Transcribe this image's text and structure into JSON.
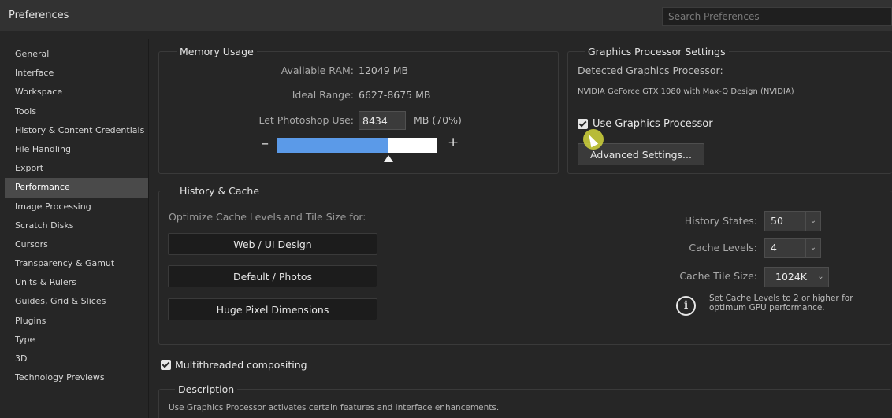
{
  "window": {
    "title": "Preferences"
  },
  "search": {
    "placeholder": "Search Preferences"
  },
  "sidebar": {
    "items": [
      {
        "label": "General"
      },
      {
        "label": "Interface"
      },
      {
        "label": "Workspace"
      },
      {
        "label": "Tools"
      },
      {
        "label": "History & Content Credentials"
      },
      {
        "label": "File Handling"
      },
      {
        "label": "Export"
      },
      {
        "label": "Performance",
        "selected": true
      },
      {
        "label": "Image Processing"
      },
      {
        "label": "Scratch Disks"
      },
      {
        "label": "Cursors"
      },
      {
        "label": "Transparency & Gamut"
      },
      {
        "label": "Units & Rulers"
      },
      {
        "label": "Guides, Grid & Slices"
      },
      {
        "label": "Plugins"
      },
      {
        "label": "Type"
      },
      {
        "label": "3D"
      },
      {
        "label": "Technology Previews"
      }
    ]
  },
  "memory": {
    "title": "Memory Usage",
    "available_label": "Available RAM:",
    "available_value": "12049 MB",
    "ideal_label": "Ideal Range:",
    "ideal_value": "6627-8675 MB",
    "use_label": "Let Photoshop Use:",
    "use_value": "8434",
    "use_unit": "MB (70%)",
    "slider_fraction": 0.7,
    "slider_minus": "–",
    "slider_plus": "+"
  },
  "gpu": {
    "title": "Graphics Processor Settings",
    "detected_label": "Detected Graphics Processor:",
    "detected_value": "NVIDIA GeForce GTX 1080 with Max-Q Design (NVIDIA)",
    "use_gpu_label": "Use Graphics Processor",
    "use_gpu_checked": true,
    "advanced_button": "Advanced Settings..."
  },
  "history_cache": {
    "title": "History & Cache",
    "optimize_label": "Optimize Cache Levels and Tile Size for:",
    "buttons": [
      "Web / UI Design",
      "Default / Photos",
      "Huge Pixel Dimensions"
    ],
    "history_states_label": "History States:",
    "history_states_value": "50",
    "cache_levels_label": "Cache Levels:",
    "cache_levels_value": "4",
    "cache_tile_label": "Cache Tile Size:",
    "cache_tile_value": "1024K",
    "info_line1": "Set Cache Levels to 2 or higher for",
    "info_line2": "optimum GPU performance."
  },
  "multithread": {
    "label": "Multithreaded compositing",
    "checked": true
  },
  "description": {
    "title": "Description",
    "text": "Use Graphics Processor activates certain features and interface enhancements."
  },
  "icons": {
    "info": "info-icon",
    "chevron": "chevron-down-icon",
    "checkbox": "checkmark-icon"
  }
}
